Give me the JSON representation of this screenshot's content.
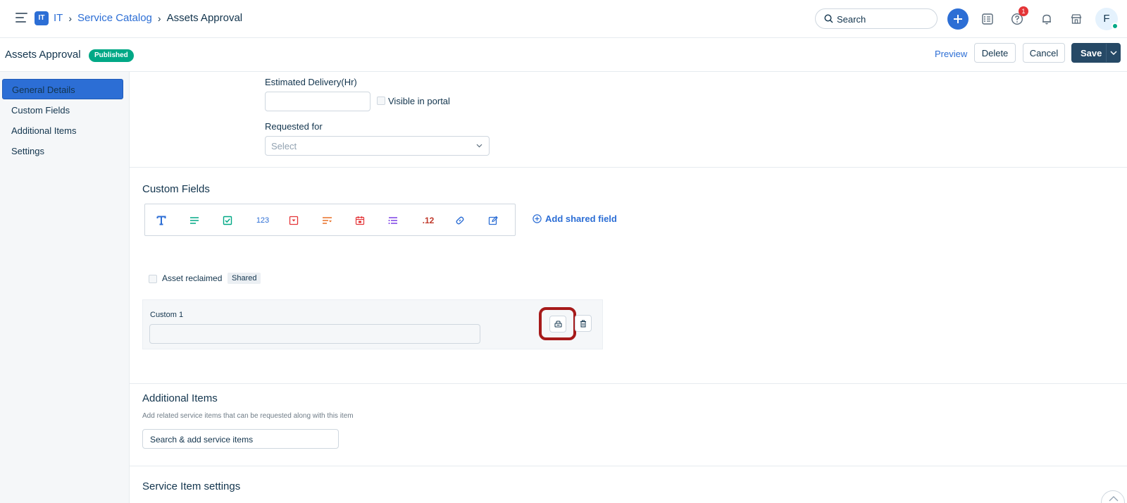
{
  "header": {
    "workspace_badge": "IT",
    "breadcrumb": [
      "IT",
      "Service Catalog",
      "Assets Approval"
    ],
    "search_placeholder": "Search",
    "notification_count": "1",
    "avatar_initial": "F"
  },
  "subheader": {
    "title": "Assets Approval",
    "status": "Published",
    "preview_label": "Preview",
    "delete_label": "Delete",
    "cancel_label": "Cancel",
    "save_label": "Save"
  },
  "sidebar": {
    "items": [
      {
        "label": "General Details",
        "active": true
      },
      {
        "label": "Custom Fields",
        "active": false
      },
      {
        "label": "Additional Items",
        "active": false
      },
      {
        "label": "Settings",
        "active": false
      }
    ]
  },
  "general": {
    "estimated_delivery_label": "Estimated Delivery(Hr)",
    "estimated_delivery_value": "",
    "visible_in_portal_label": "Visible in portal",
    "requested_for_label": "Requested for",
    "requested_for_value": "Select"
  },
  "custom_fields": {
    "title": "Custom Fields",
    "toolbar_icons": [
      "text-icon",
      "paragraph-icon",
      "checkbox-icon",
      "number-icon",
      "dropdown-icon",
      "multi-select-icon",
      "date-icon",
      "dependent-field-icon",
      "decimal-icon",
      "link-icon",
      "edit-field-icon"
    ],
    "number_tool_text": "123",
    "decimal_tool_text": ".12",
    "add_shared_label": "Add shared field",
    "asset_reclaimed_label": "Asset reclaimed",
    "shared_tag": "Shared",
    "custom1_label": "Custom 1",
    "custom1_value": ""
  },
  "additional_items": {
    "title": "Additional Items",
    "description": "Add related service items that can be requested along with this item",
    "search_placeholder": "Search & add service items"
  },
  "service_item_settings": {
    "title": "Service Item settings"
  },
  "colors": {
    "accent": "#2c6ed5",
    "save": "#264966",
    "published": "#00a886",
    "highlight": "#a61a1a"
  }
}
